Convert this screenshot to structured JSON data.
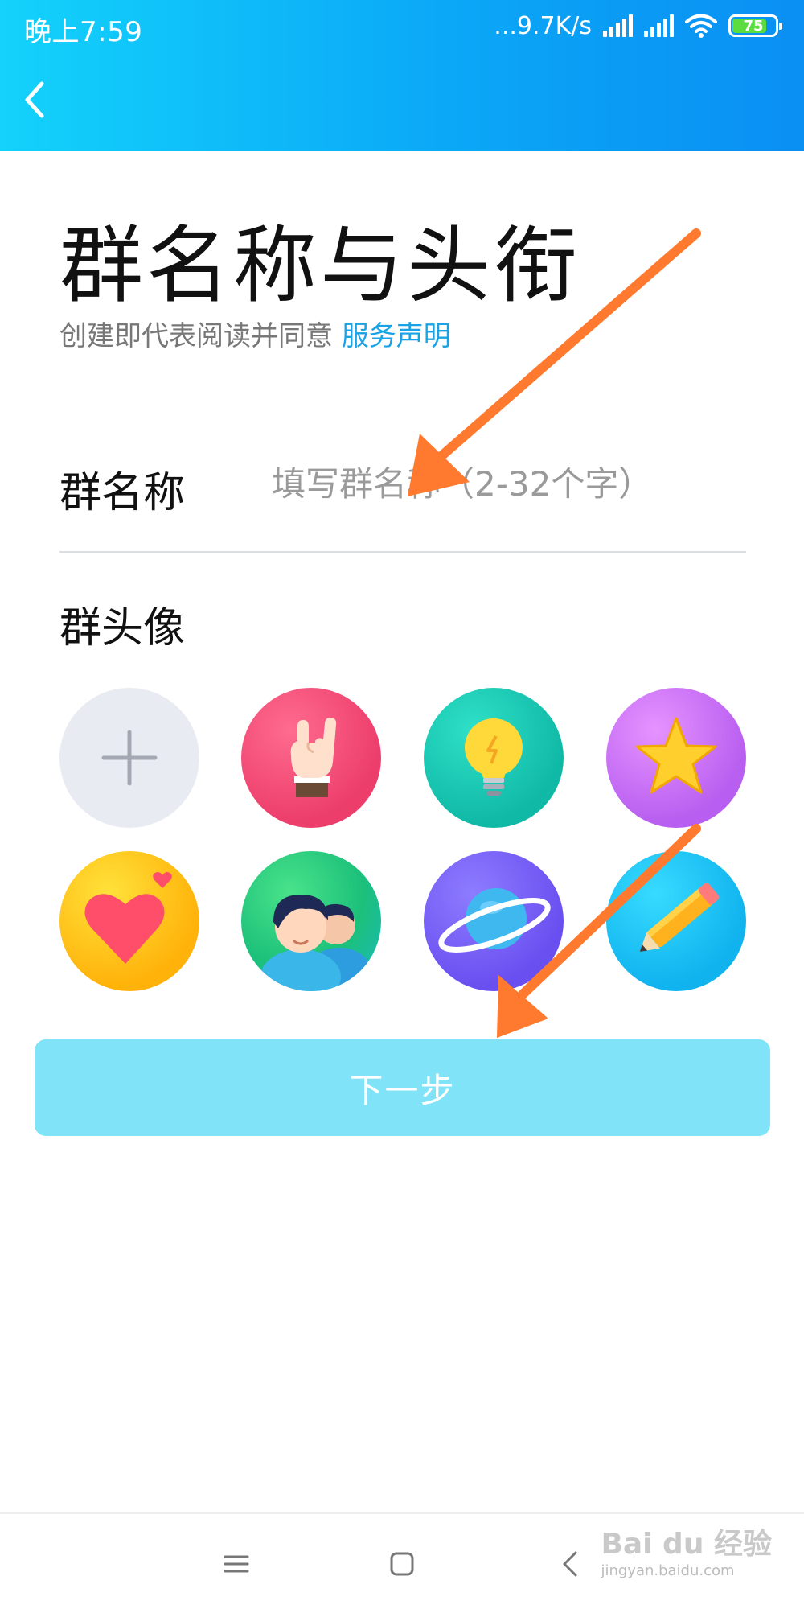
{
  "status_bar": {
    "time": "晚上7:59",
    "net_speed": "...9.7K/s",
    "battery": "75",
    "battery_color": "#5bdc3f"
  },
  "nav": {
    "back_icon": "chevron-left-icon"
  },
  "title": "群名称与头衔",
  "agreement": {
    "prefix": "创建即代表阅读并同意 ",
    "link": "服务声明"
  },
  "group_name": {
    "label": "群名称",
    "placeholder": "填写群名称（2-32个字）",
    "value": ""
  },
  "group_avatar": {
    "label": "群头像",
    "options": [
      {
        "icon": "plus-icon"
      },
      {
        "icon": "rock-hand-icon"
      },
      {
        "icon": "lightbulb-icon"
      },
      {
        "icon": "star-icon"
      },
      {
        "icon": "heart-icon"
      },
      {
        "icon": "people-icon"
      },
      {
        "icon": "planet-icon"
      },
      {
        "icon": "pencil-icon"
      }
    ]
  },
  "next_button": "下一步",
  "bottom_nav": {
    "menu_icon": "menu-icon",
    "home_icon": "home-square-icon",
    "back_icon": "back-triangle-icon"
  },
  "watermark": {
    "main": "Bai du 经验",
    "sub": "jingyan.baidu.com"
  },
  "colors": {
    "accent": "#0ba8f7",
    "link": "#1aa2e6",
    "button": "#80e3f8",
    "annotation": "#ff7a2e"
  }
}
